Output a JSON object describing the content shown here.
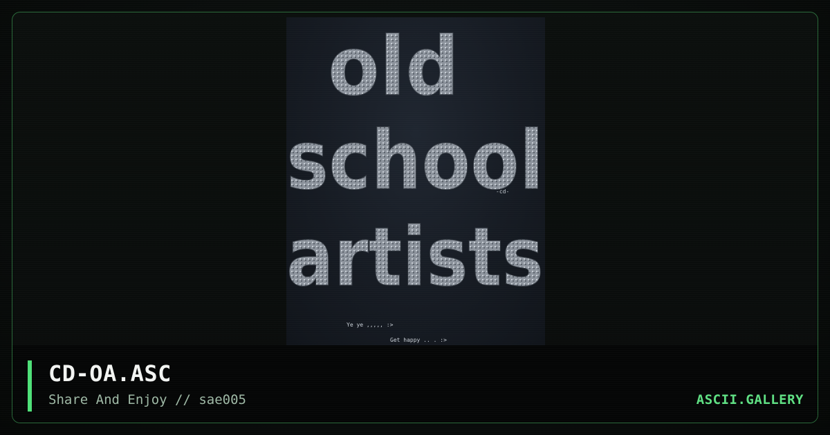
{
  "card": {
    "title": "CD-OA.ASC",
    "subtitle": "Share And Enjoy // sae005",
    "brand": "ASCII.GALLERY"
  },
  "artwork": {
    "lines": [
      "old",
      "school",
      "artists"
    ],
    "signature": "-cd-",
    "message_1": "Ye ye ,,,,, :>",
    "message_2": "Get happy .. . :>"
  },
  "colors": {
    "accent": "#4ee078",
    "brand": "#5fe083",
    "frame_border": "#2a6a3a"
  }
}
